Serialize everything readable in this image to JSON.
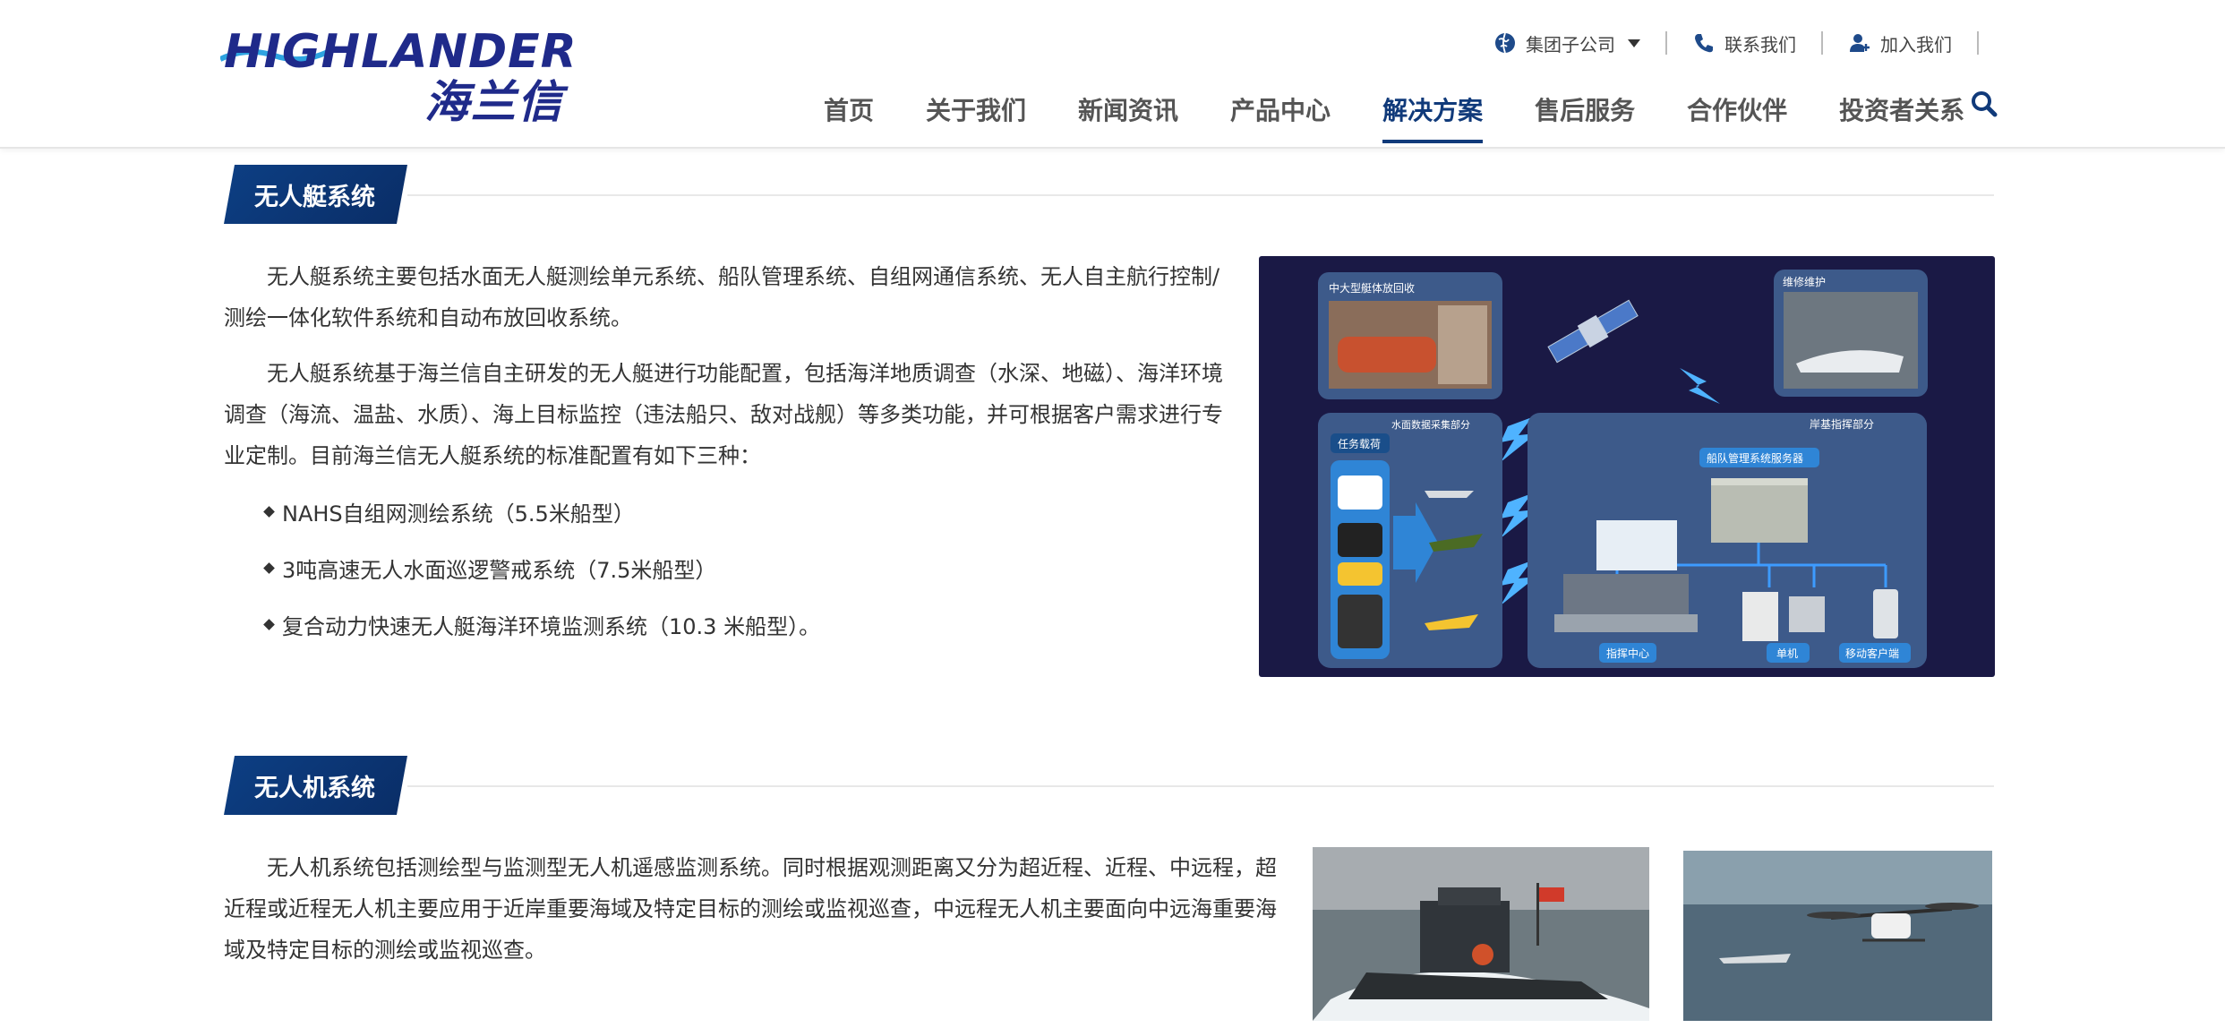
{
  "brand": {
    "name_en": "HIGHLANDER",
    "name_cn": "海兰信"
  },
  "topbar": {
    "group": "集团子公司",
    "contact": "联系我们",
    "join": "加入我们"
  },
  "nav": {
    "items": [
      "首页",
      "关于我们",
      "新闻资讯",
      "产品中心",
      "解决方案",
      "售后服务",
      "合作伙伴",
      "投资者关系"
    ],
    "active": "解决方案"
  },
  "section1": {
    "title": "无人艇系统",
    "para1_line1": "无人艇系统主要包括水面无人艇测绘单元系统、船队管理系统、自组网通信系统、无人自主航行控制/",
    "para1_line2": "测绘一体化软件系统和自动布放回收系统。",
    "para2_line1": "无人艇系统基于海兰信自主研发的无人艇进行功能配置，包括海洋地质调查（水深、地磁）、海洋环境",
    "para2_line2": "调查（海流、温盐、水质）、海上目标监控（违法船只、敌对战舰）等多类功能，并可根据客户需求进行专",
    "para2_line3": "业定制。目前海兰信无人艇系统的标准配置有如下三种：",
    "bullets": [
      "NAHS自组网测绘系统（5.5米船型）",
      "3吨高速无人水面巡逻警戒系统（7.5米船型）",
      "复合动力快速无人艇海洋环境监测系统（10.3 米船型）。"
    ],
    "diagram": {
      "label_recovery": "中大型艇体放回收",
      "label_maintenance": "维修维护",
      "label_water": "水面数据采集部分",
      "label_payload": "任务载荷",
      "label_shore": "岸基指挥部分",
      "label_server": "船队管理系统服务器",
      "label_command": "指挥中心",
      "label_single": "单机",
      "label_mobile": "移动客户端"
    }
  },
  "section2": {
    "title": "无人机系统",
    "para_line1": "无人机系统包括测绘型与监测型无人机遥感监测系统。同时根据观测距离又分为超近程、近程、中远程，超",
    "para_line2": "近程或近程无人机主要应用于近岸重要海域及特定目标的测绘或监视巡查，中远程无人机主要面向中远海重要海",
    "para_line3": "域及特定目标的测绘或监视巡查。"
  }
}
